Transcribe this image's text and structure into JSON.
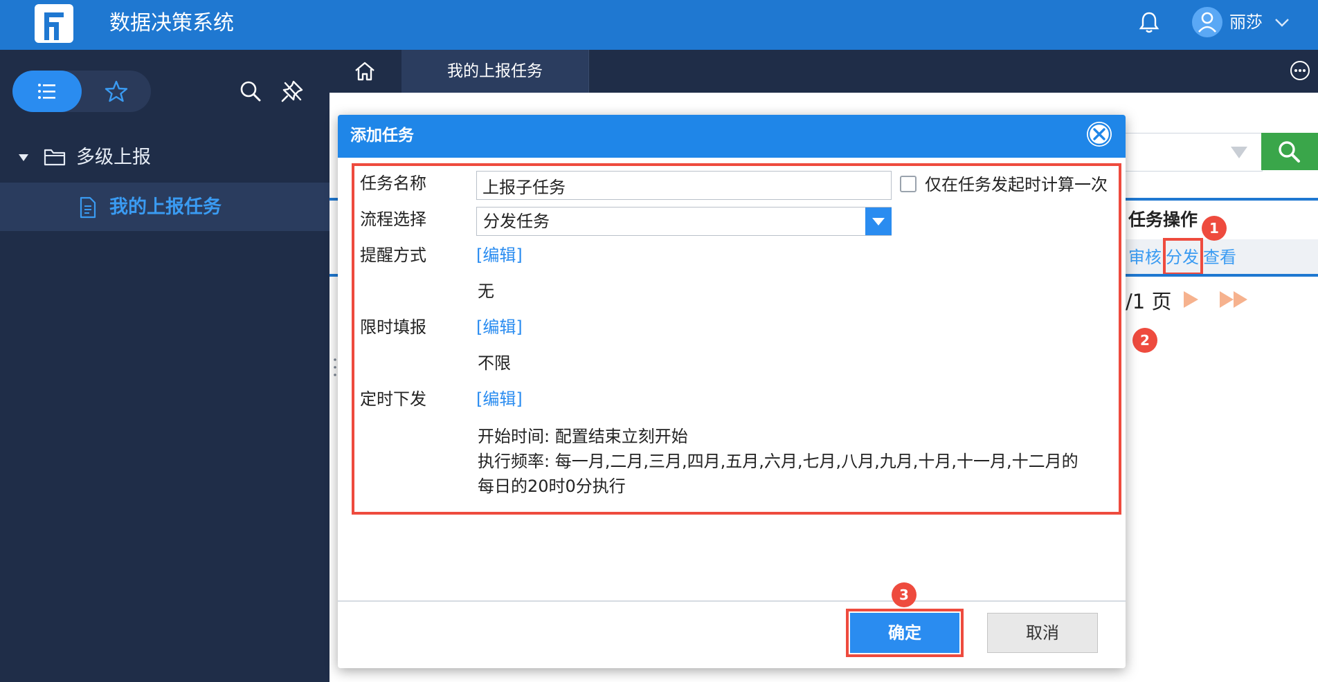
{
  "app": {
    "title": "数据决策系统",
    "user_name": "丽莎"
  },
  "sidebar": {
    "tree": [
      {
        "label": "多级上报",
        "expanded": true,
        "children": [
          {
            "label": "我的上报任务",
            "active": true
          }
        ]
      }
    ]
  },
  "tabs": [
    {
      "label": "我的上报任务",
      "active": true
    }
  ],
  "background": {
    "column_header": "任务操作",
    "row_actions": [
      "审核",
      "分发",
      "查看"
    ],
    "pagination": "/1 页"
  },
  "dialog": {
    "title": "添加任务",
    "fields": {
      "task_name": {
        "label": "任务名称",
        "value": "上报子任务"
      },
      "compute_once": {
        "label": "仅在任务发起时计算一次",
        "checked": false
      },
      "flow": {
        "label": "流程选择",
        "value": "分发任务"
      },
      "reminder": {
        "label": "提醒方式",
        "edit": "[编辑]",
        "value": "无"
      },
      "time_limit": {
        "label": "限时填报",
        "edit": "[编辑]",
        "value": "不限"
      },
      "schedule": {
        "label": "定时下发",
        "edit": "[编辑]",
        "start": "开始时间: 配置结束立刻开始",
        "frequency_1": "执行频率: 每一月,二月,三月,四月,五月,六月,七月,八月,九月,十月,十一月,十二月的",
        "frequency_2": "每日的20时0分执行"
      }
    },
    "buttons": {
      "ok": "确定",
      "cancel": "取消"
    }
  },
  "annotations": {
    "step1": "1",
    "step2": "2",
    "step3": "3"
  },
  "colors": {
    "topbar": "#1f78d1",
    "sidebar": "#1f2d48",
    "accent": "#2a8cf0",
    "highlight": "#ee4b3e"
  }
}
